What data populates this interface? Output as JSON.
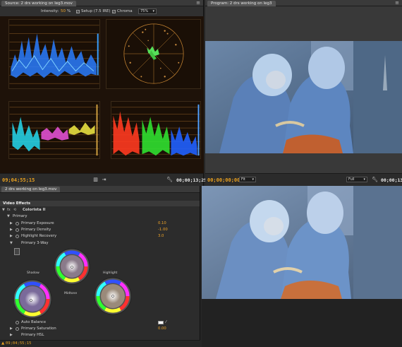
{
  "source_panel": {
    "tab_label": "Source: 2  drs working on leg3.mov",
    "intensity_label": "Intensity:",
    "intensity_value": "50",
    "intensity_unit": "%",
    "setup_label": "Setup (7.5 IRE)",
    "chroma_label": "Chroma",
    "scale_value": "75%",
    "timecode_left": "09;04;55;15",
    "timecode_right": "00;00;13;25"
  },
  "program_panel": {
    "tab_label": "Program: 2  drs working on leg3",
    "timecode_left": "00;00;00;00",
    "fit_label": "Fit",
    "full_label": "Full"
  },
  "effects_panel": {
    "tab_label": "2  drs working on leg3.mov",
    "section_label": "Video Effects",
    "effect_name": "Colorista II",
    "primary_label": "Primary",
    "params": [
      {
        "label": "Primary Exposure",
        "value": "0.10"
      },
      {
        "label": "Primary Density",
        "value": "-1.00"
      },
      {
        "label": "Highlight Recovery",
        "value": "3.0"
      }
    ],
    "three_way_label": "Primary 3-Way",
    "wheels": {
      "shadow": "Shadow",
      "midtone": "Midtone",
      "highlight": "Highlight"
    },
    "auto_balance_label": "Auto Balance",
    "primary_saturation_label": "Primary Saturation",
    "primary_saturation_value": "0.00",
    "primary_hsl_label": "Primary HSL",
    "bottom_timecode": "09;04;55;15"
  },
  "colors": {
    "timecode_orange": "#e8a020",
    "value_orange": "#f0a428",
    "scope_grid": "#c08030",
    "waveform_blue": "#2a8cff",
    "vectorscope_green": "#56e05a"
  }
}
